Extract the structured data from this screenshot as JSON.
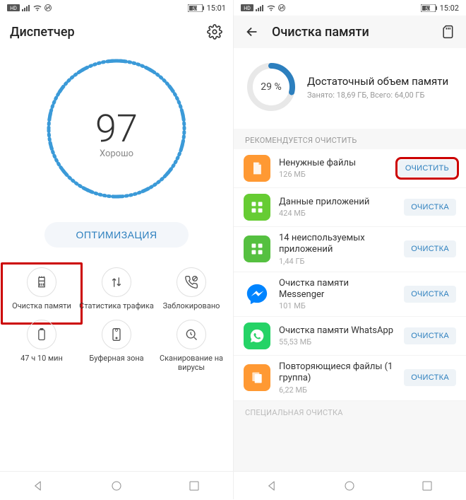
{
  "left": {
    "status": {
      "time": "15:01",
      "battery": "57"
    },
    "title": "Диспетчер",
    "gauge": {
      "score": "97",
      "label": "Хорошо"
    },
    "optimize_button": "ОПТИМИЗАЦИЯ",
    "grid": [
      {
        "label": "Очистка памяти"
      },
      {
        "label": "Статистика трафика"
      },
      {
        "label": "Заблокировано"
      },
      {
        "label": "47 ч 10 мин"
      },
      {
        "label": "Буферная зона"
      },
      {
        "label": "Сканирование на вирусы"
      }
    ]
  },
  "right": {
    "status": {
      "time": "15:02",
      "battery": "57"
    },
    "title": "Очистка памяти",
    "memory": {
      "percent": "29 %",
      "title": "Достаточный объем памяти",
      "sub": "Занято: 18,69 ГБ, Всего: 64,00 ГБ"
    },
    "section_recommend": "РЕКОМЕНДУЕТСЯ ОЧИСТИТЬ",
    "items": [
      {
        "title": "Ненужные файлы",
        "sub": "126 МБ",
        "btn": "ОЧИСТИТЬ"
      },
      {
        "title": "Данные приложений",
        "sub": "424 МБ",
        "btn": "ОЧИСТКА"
      },
      {
        "title": "14 неиспользуемых приложений",
        "sub": "1,44 ГБ",
        "btn": "ОЧИСТКА"
      },
      {
        "title": "Очистка памяти Messenger",
        "sub": "101 МБ",
        "btn": "ОЧИСТКА"
      },
      {
        "title": "Очистка памяти WhatsApp",
        "sub": "55,53 МБ",
        "btn": "ОЧИСТКА"
      },
      {
        "title": "Повторяющиеся файлы (1 группа)",
        "sub": "6,22 МБ",
        "btn": "ОЧИСТКА"
      }
    ],
    "section_special": "СПЕЦИАЛЬНАЯ ОЧИСТКА"
  }
}
